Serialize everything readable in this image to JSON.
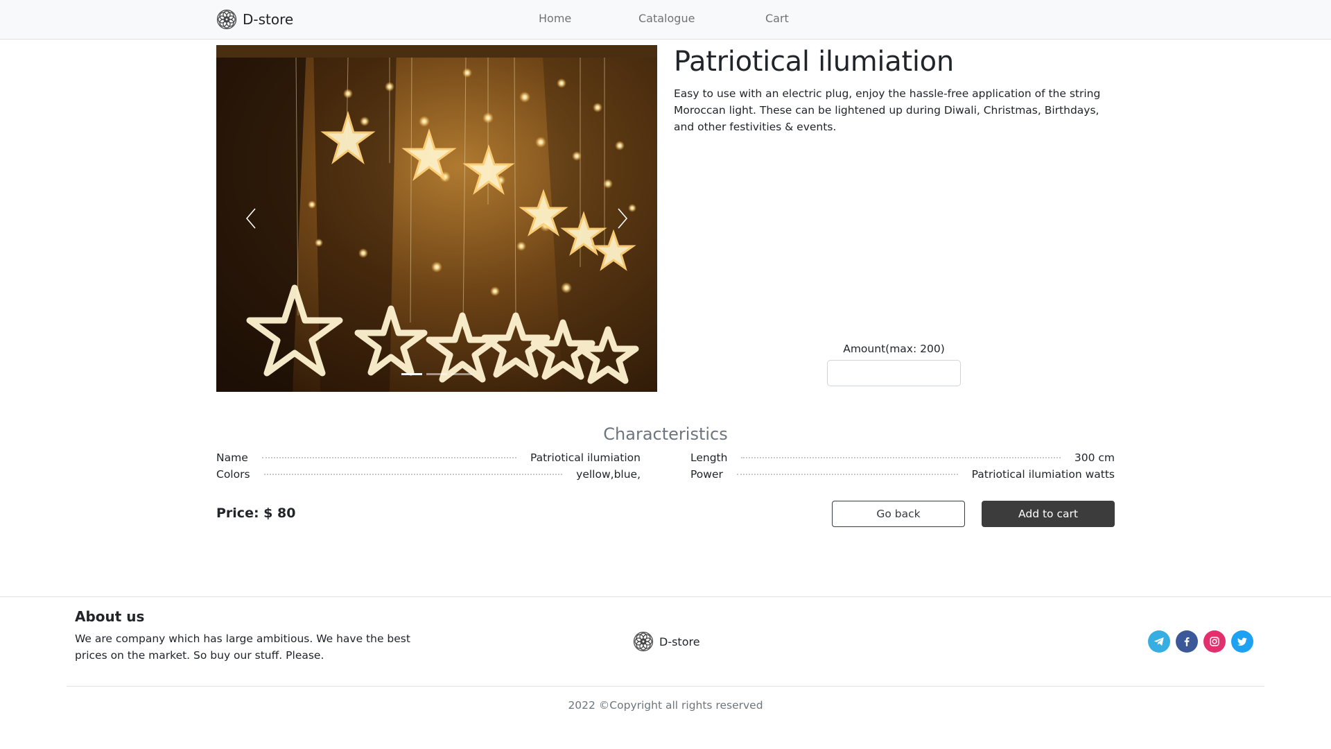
{
  "header": {
    "brand": "D-store",
    "nav": [
      {
        "label": "Home"
      },
      {
        "label": "Catalogue"
      },
      {
        "label": "Cart"
      }
    ]
  },
  "product": {
    "title": "Patriotical ilumiation",
    "description": "Easy to use with an electric plug, enjoy the hassle-free application of the string Moroccan light. These can be lightened up during Diwali, Christmas, Birthdays, and other festivities & events.",
    "image_icon": "star-string-lights-photo",
    "carousel": {
      "prev_icon": "chevron-left-icon",
      "next_icon": "chevron-right-icon",
      "slides": 3,
      "active_slide": 1
    },
    "amount": {
      "label": "Amount(max: 200)",
      "value": "",
      "placeholder": ""
    },
    "characteristics_title": "Characteristics",
    "characteristics": [
      {
        "key": "Name",
        "value": "Patriotical ilumiation"
      },
      {
        "key": "Colors",
        "value": "yellow,blue,"
      },
      {
        "key": "Length",
        "value": "300 cm"
      },
      {
        "key": "Power",
        "value": "Patriotical ilumiation watts"
      }
    ],
    "price_text": "Price: $ 80",
    "buttons": {
      "back": "Go back",
      "add_to_cart": "Add to cart"
    }
  },
  "footer": {
    "about_title": "About us",
    "about_text": "We are company which has large ambitious. We have the best prices on the market. So buy our stuff. Please.",
    "brand": "D-store",
    "socials": [
      {
        "icon": "telegram-icon",
        "color": "#37aee2"
      },
      {
        "icon": "facebook-icon",
        "color": "#3b5998"
      },
      {
        "icon": "instagram-icon",
        "color": "#e1306c"
      },
      {
        "icon": "twitter-icon",
        "color": "#1da1f2"
      }
    ],
    "copyright": "2022 ©Copyright all rights reserved"
  }
}
